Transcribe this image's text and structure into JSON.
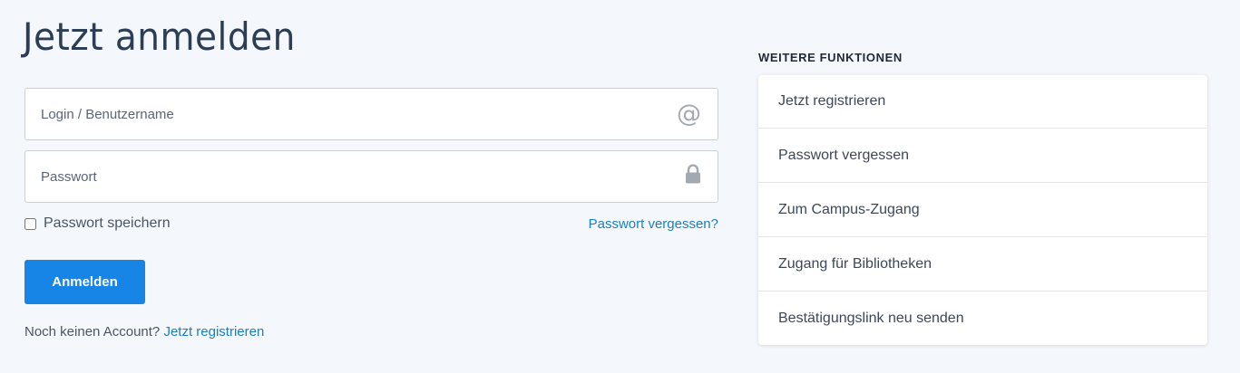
{
  "page": {
    "title": "Jetzt anmelden"
  },
  "form": {
    "login_placeholder": "Login / Benutzername",
    "password_placeholder": "Passwort",
    "remember_label": "Passwort speichern",
    "forgot_link": "Passwort vergessen?",
    "submit_label": "Anmelden",
    "no_account_text": "Noch keinen Account?",
    "register_link": "Jetzt registrieren",
    "login_icon": "at-icon",
    "password_icon": "lock-icon"
  },
  "sidebar": {
    "heading": "WEITERE FUNKTIONEN",
    "items": [
      {
        "label": "Jetzt registrieren"
      },
      {
        "label": "Passwort vergessen"
      },
      {
        "label": "Zum Campus-Zugang"
      },
      {
        "label": "Zugang für Bibliotheken"
      },
      {
        "label": "Bestätigungslink neu senden"
      }
    ]
  },
  "colors": {
    "background": "#f4f7fb",
    "primary_button": "#1685e5",
    "link": "#1c7fc4"
  }
}
